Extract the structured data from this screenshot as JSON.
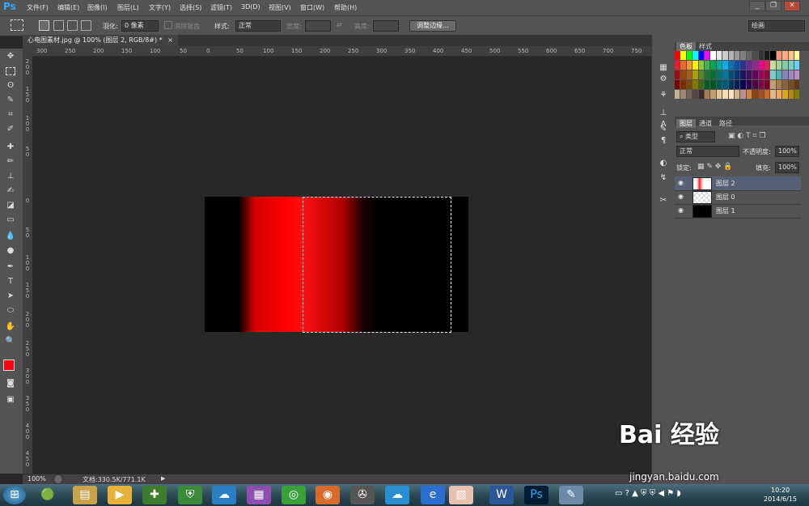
{
  "app": {
    "logo": "Ps",
    "menu": [
      "文件(F)",
      "编辑(E)",
      "图像(I)",
      "图层(L)",
      "文字(Y)",
      "选择(S)",
      "滤镜(T)",
      "3D(D)",
      "视图(V)",
      "窗口(W)",
      "帮助(H)"
    ],
    "window_buttons": [
      "_",
      "❐",
      "✕"
    ]
  },
  "options": {
    "feather_label": "羽化:",
    "feather_value": "0 像素",
    "antialias_label": "消除锯齿",
    "style_label": "样式:",
    "style_value": "正常",
    "width_label": "宽度:",
    "height_label": "高度:",
    "refine_edge": "调整边缘...",
    "workspace": "绘画"
  },
  "document": {
    "tab_title": "心电图素材.jpg @ 100% (图层 2, RGB/8#) *",
    "close": "×",
    "ruler_h": [
      "300",
      "250",
      "200",
      "150",
      "100",
      "50",
      "0",
      "50",
      "100",
      "150",
      "200",
      "250",
      "300",
      "350",
      "400",
      "450",
      "500",
      "550",
      "600",
      "650",
      "700",
      "750"
    ],
    "ruler_v": [
      "2 0 0",
      "1 5 0",
      "1 0 0",
      "5 0",
      "0",
      "5 0",
      "1 0 0",
      "1 5 0",
      "2 0 0",
      "2 5 0",
      "3 0 0",
      "3 5 0",
      "4 0 0",
      "4 5 0"
    ]
  },
  "status": {
    "zoom": "100%",
    "doc_info": "文档:330.5K/771.1K"
  },
  "panels": {
    "swatch_tabs": [
      "色板",
      "样式"
    ],
    "layer_tabs": [
      "图层",
      "通道",
      "路径"
    ],
    "filter_kind": "类型",
    "blend_mode": "正常",
    "opacity_label": "不透明度:",
    "opacity_value": "100%",
    "lock_label": "锁定:",
    "fill_label": "填充:",
    "fill_value": "100%",
    "layers": [
      {
        "name": "图层 2",
        "selected": true
      },
      {
        "name": "图层 0",
        "selected": false
      },
      {
        "name": "图层 1",
        "selected": false
      }
    ]
  },
  "taskbar": {
    "time": "10:20",
    "date": "2014/6/15"
  },
  "watermark": {
    "brand": "Bai 经验",
    "url": "jingyan.baidu.com"
  }
}
